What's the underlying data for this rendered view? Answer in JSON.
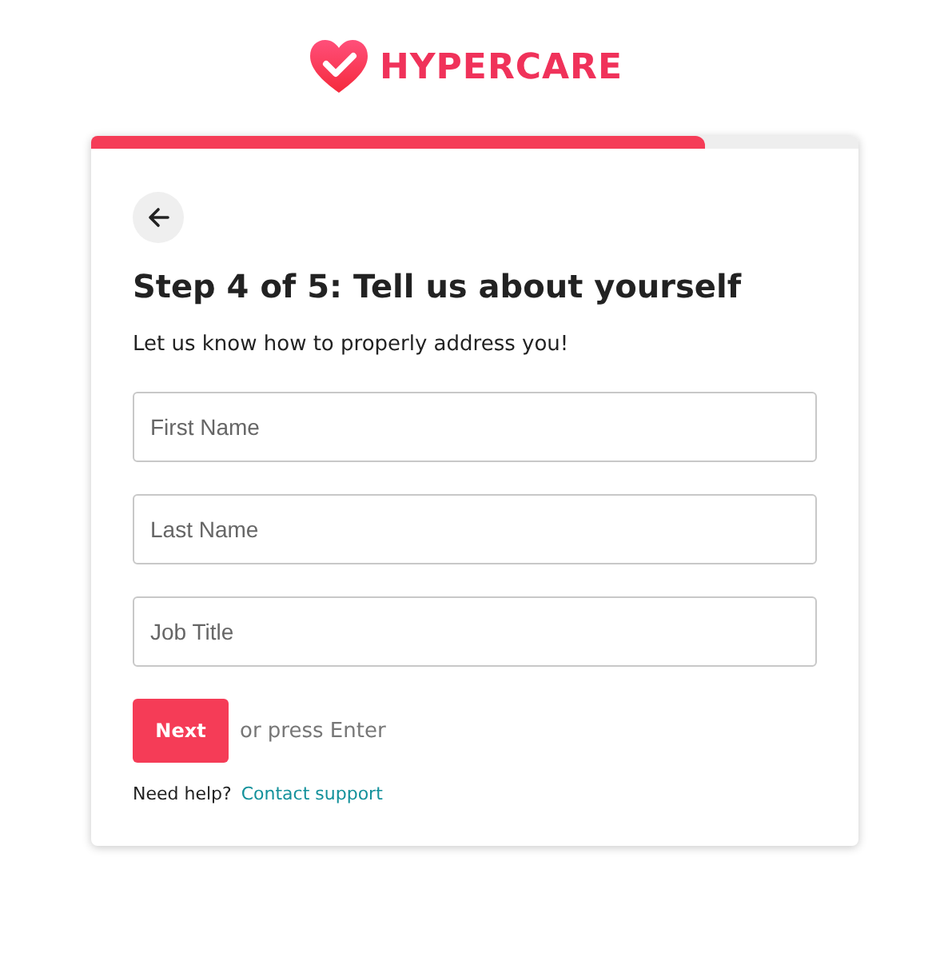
{
  "brand": {
    "name": "HYPERCARE"
  },
  "progress": {
    "level": 0.8
  },
  "form": {
    "title": "Step 4 of 5: Tell us about yourself",
    "subtitle": "Let us know how to properly address you!",
    "fields": [
      {
        "placeholder": "First Name"
      },
      {
        "placeholder": "Last Name"
      },
      {
        "placeholder": "Job Title"
      }
    ],
    "submit": {
      "label": "Next",
      "hint": "or press Enter"
    },
    "help": {
      "text": "Need help?",
      "link": "Contact support"
    }
  }
}
